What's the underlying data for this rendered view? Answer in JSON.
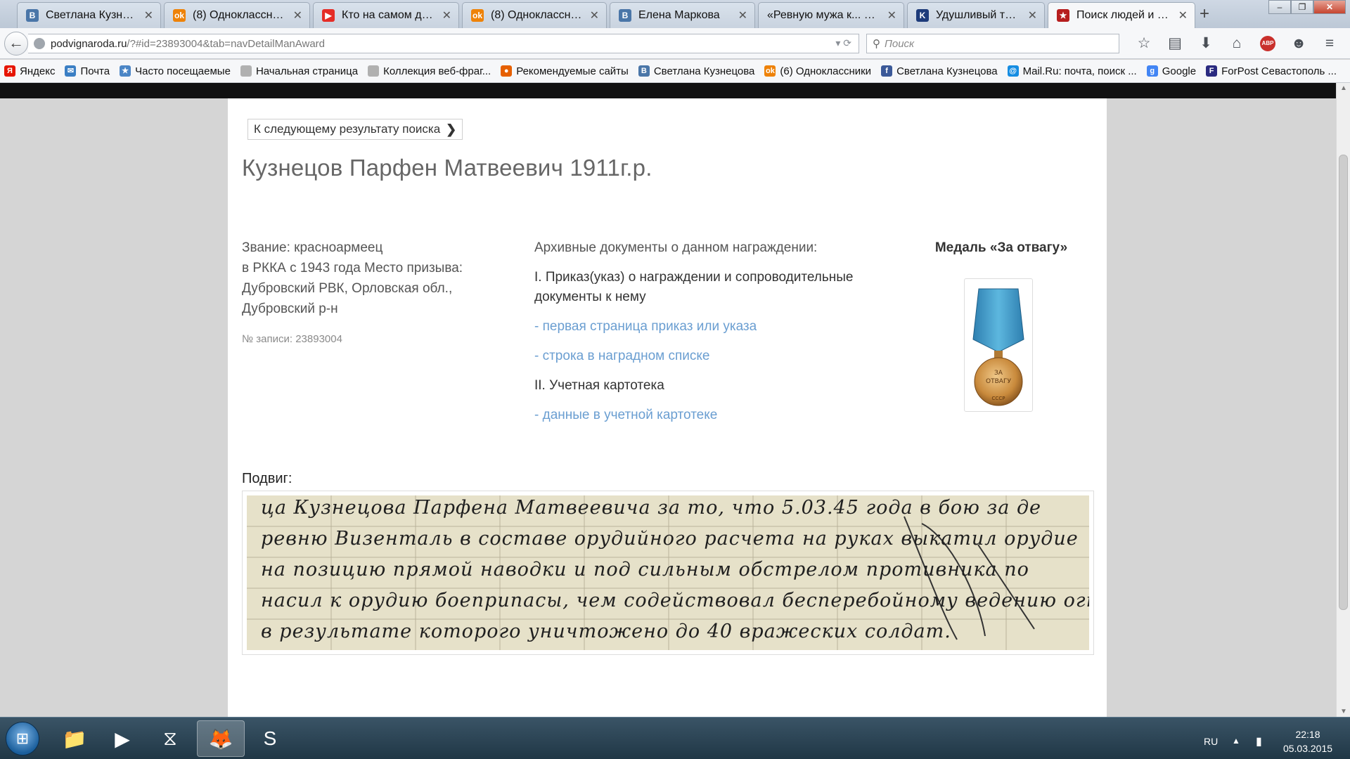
{
  "browser": {
    "tabs": [
      {
        "title": "Светлана Кузнецо...",
        "favicon": "vk-icon",
        "color": "#4a76a8",
        "glyph": "В"
      },
      {
        "title": "(8) Одноклассники",
        "favicon": "odnoklassniki-icon",
        "color": "#ee8208",
        "glyph": "ok"
      },
      {
        "title": "Кто на самом дел...",
        "favicon": "youtube-icon",
        "color": "#e52d27",
        "glyph": "▶"
      },
      {
        "title": "(8) Одноклассники",
        "favicon": "odnoklassniki-icon",
        "color": "#ee8208",
        "glyph": "ok"
      },
      {
        "title": "Елена Маркова",
        "favicon": "vk-icon",
        "color": "#4a76a8",
        "glyph": "В"
      },
      {
        "title": "«Ревную мужа к... фут...",
        "favicon": "",
        "color": "",
        "glyph": ""
      },
      {
        "title": "Удушливый траур...",
        "favicon": "kommersant-icon",
        "color": "#1d3b7a",
        "glyph": "K"
      },
      {
        "title": "Поиск людей и на...",
        "favicon": "podvig-naroda-icon",
        "color": "#b61e1e",
        "glyph": "★"
      }
    ],
    "url": {
      "host": "podvignaroda.ru",
      "rest": "/?#id=23893004&tab=navDetailManAward"
    },
    "search_placeholder": "Поиск",
    "bookmarks": [
      {
        "label": "Яндекс",
        "icon": "yandex-icon",
        "color": "#e61400",
        "glyph": "Я"
      },
      {
        "label": "Почта",
        "icon": "mail-icon",
        "color": "#3b7fc4",
        "glyph": "✉"
      },
      {
        "label": "Часто посещаемые",
        "icon": "frequent-icon",
        "color": "#4c86c6",
        "glyph": "★"
      },
      {
        "label": "Начальная страница",
        "icon": "page-icon",
        "color": "#b0b0b0",
        "glyph": ""
      },
      {
        "label": "Коллекция веб-фраг...",
        "icon": "page-icon",
        "color": "#b0b0b0",
        "glyph": ""
      },
      {
        "label": "Рекомендуемые сайты",
        "icon": "firefox-bookmark-icon",
        "color": "#e66000",
        "glyph": "●"
      },
      {
        "label": "Светлана Кузнецова",
        "icon": "vk-icon",
        "color": "#4a76a8",
        "glyph": "В"
      },
      {
        "label": "(6) Одноклассники",
        "icon": "odnoklassniki-icon",
        "color": "#ee8208",
        "glyph": "ok"
      },
      {
        "label": "Светлана Кузнецова",
        "icon": "facebook-icon",
        "color": "#3b5998",
        "glyph": "f"
      },
      {
        "label": "Mail.Ru: почта, поиск ...",
        "icon": "mailru-icon",
        "color": "#168de2",
        "glyph": "@"
      },
      {
        "label": "Google",
        "icon": "google-icon",
        "color": "#4285f4",
        "glyph": "g"
      },
      {
        "label": "ForPost Севастополь ...",
        "icon": "forpost-icon",
        "color": "#2a2a80",
        "glyph": "F"
      }
    ]
  },
  "page": {
    "next_result_label": "К следующему результату поиска",
    "person_title": "Кузнецов Парфен Матвеевич 1911г.р.",
    "info_lines": [
      "Звание: красноармеец",
      "в РККА с 1943 года Место призыва:",
      "Дубровский РВК, Орловская обл.,",
      "Дубровский р-н"
    ],
    "record_number": "№ записи: 23893004",
    "archive_header": "Архивные документы о данном награждении:",
    "section_1": "I. Приказ(указ) о награждении и сопроводительные документы к нему",
    "link_first_page": "- первая страница приказ или указа",
    "link_award_list": "- строка в наградном списке",
    "section_2": "II. Учетная картотека",
    "link_card_file": "- данные в учетной картотеке",
    "medal_name": "Медаль «За отвагу»",
    "medal_inscription_1": "ЗА",
    "medal_inscription_2": "ОТВАГУ",
    "medal_inscription_3": "СССР",
    "feat_label": "Подвиг:",
    "feat_lines": [
      "ца Кузнецова Парфена Матвеевича за то, что 5.03.45 года в бою за де",
      "ревню Визенталь в составе орудийного расчета на руках выкатил орудие",
      "на позицию прямой наводки и под сильным обстрелом противника по",
      "насил к орудию боеприпасы, чем содействовал бесперебойному ведению огня,",
      "в результате которого уничтожено до 40 вражеских солдат."
    ]
  },
  "taskbar": {
    "language": "RU",
    "time": "22:18",
    "date": "05.03.2015"
  }
}
